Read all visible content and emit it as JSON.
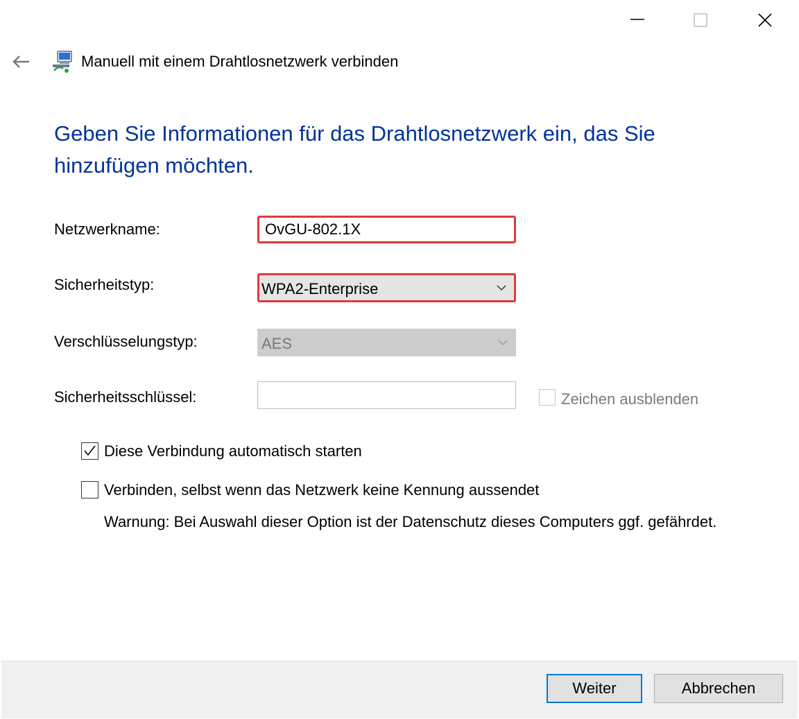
{
  "window": {
    "title": "Manuell mit einem Drahtlosnetzwerk verbinden",
    "controls": {
      "minimize": "minimize-icon",
      "maximize": "maximize-icon",
      "close": "close-icon"
    }
  },
  "heading": "Geben Sie Informationen für das Drahtlosnetzwerk ein, das Sie hinzufügen möchten.",
  "form": {
    "network_name_label": "Netzwerkname:",
    "network_name_value": "OvGU-802.1X",
    "security_type_label": "Sicherheitstyp:",
    "security_type_value": "WPA2-Enterprise",
    "encryption_type_label": "Verschlüsselungstyp:",
    "encryption_type_value": "AES",
    "security_key_label": "Sicherheitsschlüssel:",
    "security_key_value": "",
    "hide_characters_label": "Zeichen ausblenden",
    "hide_characters_checked": false
  },
  "options": {
    "auto_start_label": "Diese Verbindung automatisch starten",
    "auto_start_checked": true,
    "connect_hidden_label": "Verbinden, selbst wenn das Netzwerk keine Kennung aussendet",
    "connect_hidden_checked": false,
    "warning": "Warnung: Bei Auswahl dieser Option ist der Datenschutz dieses Computers ggf. gefährdet."
  },
  "buttons": {
    "next": "Weiter",
    "cancel": "Abbrechen"
  },
  "colors": {
    "heading": "#003399",
    "highlight_border": "#e0383e",
    "default_button_border": "#0078d7"
  }
}
